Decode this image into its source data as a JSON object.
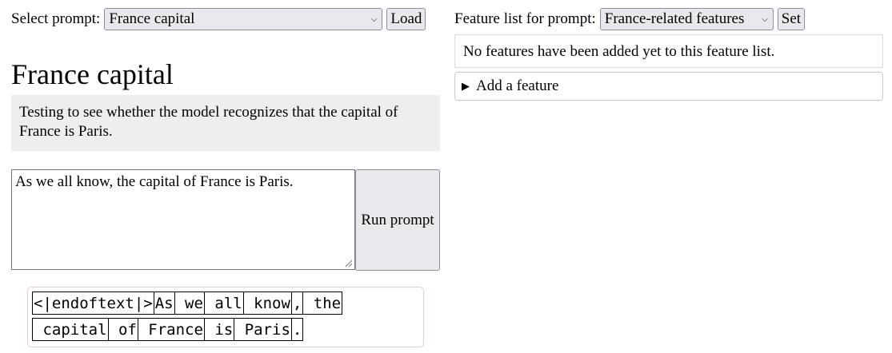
{
  "left": {
    "select_label": "Select prompt:",
    "selected_prompt": "France capital",
    "load_label": "Load",
    "title": "France capital",
    "description": "Testing to see whether the model recognizes that the capital of France is Paris.",
    "prompt_text": "As we all know, the capital of France is Paris.",
    "run_label": "Run prompt",
    "tokens_line1": [
      "<|endoftext|>",
      "As",
      " we",
      " all",
      " know",
      ",",
      " the"
    ],
    "tokens_line2": [
      " capital",
      " of",
      " France",
      " is",
      " Paris",
      "."
    ]
  },
  "right": {
    "feature_label": "Feature list for prompt:",
    "selected_feature_list": "France-related features",
    "set_label": "Set",
    "empty_message": "No features have been added yet to this feature list.",
    "add_feature_label": "Add a feature"
  },
  "icons": {
    "dropdown": "chevron-down-icon",
    "disclosure": "disclosure-triangle-icon",
    "resize": "resize-handle-icon"
  }
}
